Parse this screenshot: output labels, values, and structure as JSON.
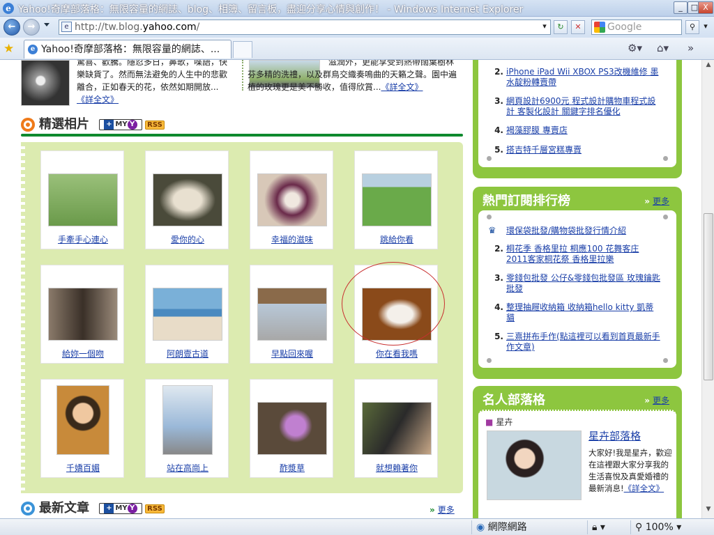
{
  "window": {
    "title": "Yahoo!奇摩部落格：無限容量的網誌、blog、相簿、留言板，盡迎分享心情與創作！ - Windows Internet Explorer",
    "min": "_",
    "max": "□",
    "close": "X"
  },
  "address": {
    "prefix": "http://tw.blog.",
    "domain": "yahoo.com",
    "suffix": "/",
    "search_placeholder": "Google"
  },
  "tab": {
    "label": "Yahoo!奇摩部落格：無限容量的網誌、..."
  },
  "articles": [
    {
      "text": "驚喜、歡騰。隱忍多日，鼻歌，喋語，快樂缺貨了。然而無法避免的人生中的悲歡離合，正如春天的花，依然如期開放...",
      "link": "《詳全文》"
    },
    {
      "text": "滋潤外，更能享受到熱帶闊葉樹林芬多精的洗禮，以及群鳥交織奏鳴曲的天籟之聲。園中遍植的玫瑰更是美不勝收，值得欣賞...",
      "link": "《詳全文》"
    }
  ],
  "featured": {
    "title": "精選相片",
    "my": "MY",
    "rss": "RSS"
  },
  "photos": [
    {
      "caption": "手牽手心連心",
      "bg": "#6a9a4a"
    },
    {
      "caption": "愛你的心",
      "bg": "#4a4a3a"
    },
    {
      "caption": "幸福的滋味",
      "bg": "#7a4a5a"
    },
    {
      "caption": "跳給你看",
      "bg": "#6aaa4a"
    },
    {
      "caption": "給妳一個吻",
      "bg": "#6a5a4a"
    },
    {
      "caption": "阿朗壹古道",
      "bg": "#7ab0d8"
    },
    {
      "caption": "早點回來喔",
      "bg": "#8a8a8a"
    },
    {
      "caption": "你在看我嗎",
      "bg": "#8a4a1a"
    },
    {
      "caption": "千嬌百媚",
      "bg": "#c88a3a"
    },
    {
      "caption": "站在高崗上",
      "bg": "#9ab8d8"
    },
    {
      "caption": "酢漿草",
      "bg": "#5a4a3a"
    },
    {
      "caption": "就想賴著你",
      "bg": "#5a6a3a"
    }
  ],
  "latest": {
    "title": "最新文章",
    "my": "MY",
    "rss": "RSS",
    "more": "更多"
  },
  "top_list": [
    {
      "num": "2.",
      "text": "iPhone iPad Wii XBOX PS3改機維修 墨水靛粉轉賣帶"
    },
    {
      "num": "3.",
      "text": "網頁設計6900元 程式設計購物車程式設計 客製化設計 關鍵字排名優化"
    },
    {
      "num": "4.",
      "text": "褐藻膠膜 專賣店"
    },
    {
      "num": "5.",
      "text": "搭吉特千層宮糕專賣"
    }
  ],
  "subscribe": {
    "title": "熱門訂閱排行榜",
    "more": "更多",
    "items": [
      {
        "num": "",
        "text": "環保袋批發/購物袋批發行情介紹"
      },
      {
        "num": "2.",
        "text": "桐花季 香格里拉 桐應100 花舞客庄 2011客家桐花祭 香格里拉樂"
      },
      {
        "num": "3.",
        "text": "零錢包批發 公仔&零錢包批發區 玫瑰鑰匙批發"
      },
      {
        "num": "4.",
        "text": "整理抽屜收納箱 收納箱hello kitty 凱蒂貓"
      },
      {
        "num": "5.",
        "text": "三熹拼布手作(點這裡可以看到首頁最新手作文章)"
      }
    ]
  },
  "celebrity": {
    "title": "名人部落格",
    "more": "更多",
    "name": "星卉",
    "blog": "星卉部落格",
    "desc": "大家好!我是星卉，歡迎在這裡跟大家分享我的生活喜悅及真愛婚禮的最新消息!",
    "link": "《詳全文》"
  },
  "status": {
    "zone": "網際網路",
    "zoom": "100%"
  }
}
